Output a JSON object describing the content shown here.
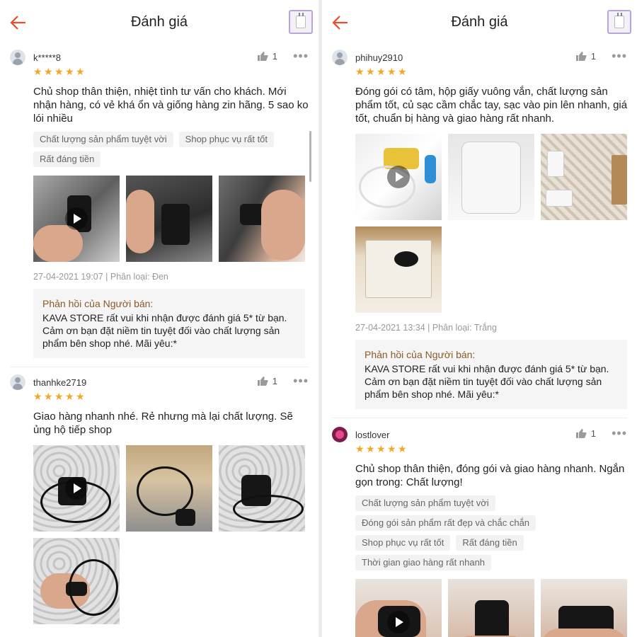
{
  "colors": {
    "accent": "#ee4d2d",
    "star": "#f5a623",
    "reply_title": "#8a5a25"
  },
  "panels": [
    {
      "header": {
        "title": "Đánh giá",
        "back_icon": "arrow-left-icon",
        "product_icon": "product-thumbnail-icon"
      },
      "reviews": [
        {
          "username": "k*****8",
          "avatar": "default",
          "likes": "1",
          "more": "•••",
          "rating": 5,
          "text": "Chủ shop thân thiện, nhiệt tình tư vấn cho khách. Mới nhận hàng, có vẻ khá ổn và giống hàng zin hãng. 5 sao ko lói nhiều",
          "tags": [
            "Chất lượng sản phẩm tuyệt vời",
            "Shop phục vụ rất tốt",
            "Rất đáng tiền"
          ],
          "photos": [
            "video",
            "photo",
            "photo"
          ],
          "meta": "27-04-2021 19:07 | Phân loại: Đen",
          "reply_title": "Phản hồi của Người bán:",
          "reply_body": "KAVA STORE rất vui khi nhận được đánh giá 5* từ bạn. Cảm ơn bạn đặt niềm tin tuyệt đối vào chất lượng sản phẩm bên shop nhé. Mãi yêu:*"
        },
        {
          "username": "thanhke2719",
          "avatar": "default",
          "likes": "1",
          "more": "•••",
          "rating": 5,
          "text": "Giao hàng nhanh nhé. Rẻ nhưng mà lại chất lượng. Sẽ ủng hộ tiếp shop",
          "tags": [],
          "photos": [
            "video",
            "photo",
            "photo",
            "photo"
          ],
          "meta": "",
          "reply_title": "",
          "reply_body": ""
        }
      ]
    },
    {
      "header": {
        "title": "Đánh giá",
        "back_icon": "arrow-left-icon",
        "product_icon": "product-thumbnail-icon"
      },
      "reviews": [
        {
          "username": "phihuy2910",
          "avatar": "default",
          "likes": "1",
          "more": "•••",
          "rating": 5,
          "text": "Đóng gói có tâm, hộp giấy vuông vắn, chất lượng sản phẩm tốt, củ sạc cầm chắc tay, sạc vào pin lên nhanh, giá tốt, chuẩn bị hàng và giao hàng rất nhanh.",
          "tags": [],
          "photos": [
            "video",
            "photo",
            "photo",
            "photo"
          ],
          "meta": "27-04-2021 13:34 | Phân loại: Trắng",
          "reply_title": "Phản hồi của Người bán:",
          "reply_body": "KAVA STORE rất vui khi nhận được đánh giá 5* từ bạn. Cảm ơn bạn đặt niềm tin tuyệt đối vào chất lượng sản phẩm bên shop nhé. Mãi yêu:*"
        },
        {
          "username": "lostlover",
          "avatar": "custom",
          "likes": "1",
          "more": "•••",
          "rating": 5,
          "text": "Chủ shop thân thiện, đóng gói và giao hàng nhanh. Ngắn gọn trong: Chất lượng!",
          "tags": [
            "Chất lượng sản phẩm tuyệt vời",
            "Đóng gói sản phẩm rất đẹp và chắc chắn",
            "Shop phục vụ rất tốt",
            "Rất đáng tiền",
            "Thời gian giao hàng rất nhanh"
          ],
          "photos": [
            "video",
            "photo",
            "photo"
          ],
          "meta": "",
          "reply_title": "",
          "reply_body": ""
        }
      ]
    }
  ]
}
